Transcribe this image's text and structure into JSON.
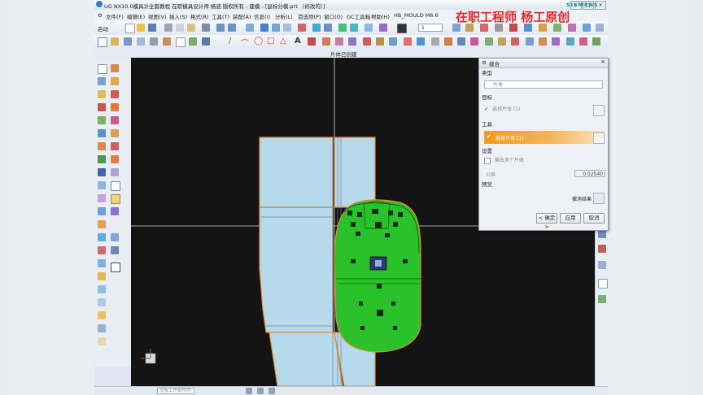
{
  "window": {
    "title": "UG NX10.0模具计全套教程 在职模具设计师 杨波 版权所有 - 建模 - [鼠标分模.prt （修改的）]",
    "brand": "SIEMENS",
    "watermark": "在职工程师  杨工原创"
  },
  "menu": [
    "文件(F)",
    "编辑(E)",
    "视图(V)",
    "插入(S)",
    "格式(R)",
    "工具(T)",
    "装配(A)",
    "信息(I)",
    "分析(L)",
    "首选项(P)",
    "窗口(O)",
    "GC工具箱",
    "帮助(H)",
    "HB_MOULD M6.6"
  ],
  "toolbar": {
    "start_label": "启动",
    "layer_value": "1"
  },
  "command_line": "片体已创建",
  "dialog": {
    "title": "缝合",
    "type_header": "类型",
    "type_value": "片体",
    "target_header": "目标",
    "target_value": "选择片体 (1)",
    "tool_header": "工具",
    "tool_value": "选择片体 (1)",
    "settings_header": "设置",
    "multi_sheet_label": "输出多个片体",
    "tolerance_label": "公差",
    "tolerance_value": "0.02540",
    "preview_header": "预览",
    "preview_label": "撤消结果",
    "ok_label": "< 确定 >",
    "apply_label": "应用",
    "cancel_label": "取消"
  },
  "status": {
    "selection_filter": "没有工作部件内"
  },
  "colors": {
    "viewport": "#141414",
    "part_green": "#29c22a",
    "part_blue": "#b7d9ec",
    "accent_orange": "#f39a1e",
    "watermark": "#e0262a"
  }
}
